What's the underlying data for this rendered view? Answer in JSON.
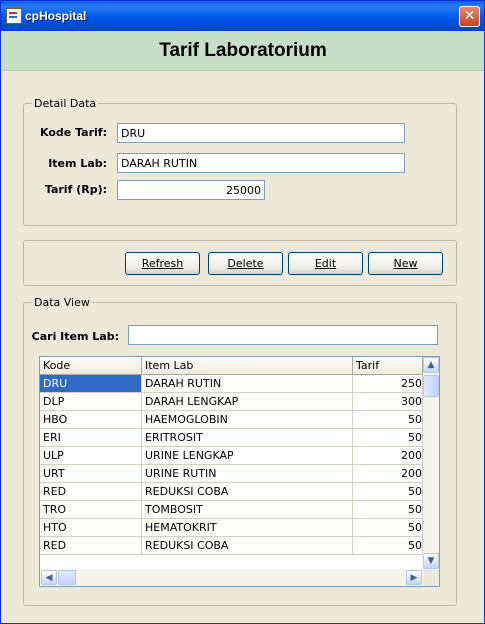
{
  "window": {
    "title": "cpHospital",
    "close_glyph": "✕"
  },
  "header": {
    "title": "Tarif Laboratorium"
  },
  "detail": {
    "legend": "Detail Data",
    "kode_label": "Kode Tarif:",
    "kode_value": "DRU",
    "item_label": "Item Lab:",
    "item_value": "DARAH RUTIN",
    "tarif_label": "Tarif (Rp):",
    "tarif_value": "25000"
  },
  "actions": {
    "refresh": "Refresh",
    "delete": "Delete",
    "edit": "Edit",
    "new": "New"
  },
  "view": {
    "legend": "Data View",
    "search_label": "Cari Item Lab:",
    "search_value": ""
  },
  "table": {
    "columns": [
      "Kode",
      "Item Lab",
      "Tarif"
    ],
    "rows": [
      [
        "DRU",
        "DARAH RUTIN",
        "250"
      ],
      [
        "DLP",
        "DARAH LENGKAP",
        "300"
      ],
      [
        "HBO",
        "HAEMOGLOBIN",
        "50"
      ],
      [
        "ERI",
        "ERITROSIT",
        "50"
      ],
      [
        "ULP",
        "URINE LENGKAP",
        "200"
      ],
      [
        "URT",
        "URINE RUTIN",
        "200"
      ],
      [
        "RED",
        "REDUKSI COBA",
        "50"
      ],
      [
        "TRO",
        "TOMBOSIT",
        "50"
      ],
      [
        "HTO",
        "HEMATOKRIT",
        "50"
      ],
      [
        "RED",
        "REDUKSI COBA",
        "50"
      ]
    ],
    "selected_row": 0
  },
  "icons": {
    "scroll_up": "▲",
    "scroll_down": "▼",
    "scroll_left": "◀",
    "scroll_right": "▶"
  },
  "colors": {
    "titlebar": "#0058E6",
    "header_bg": "#C7DFC7",
    "selection": "#316AC5",
    "window_bg": "#ECE9D8"
  }
}
